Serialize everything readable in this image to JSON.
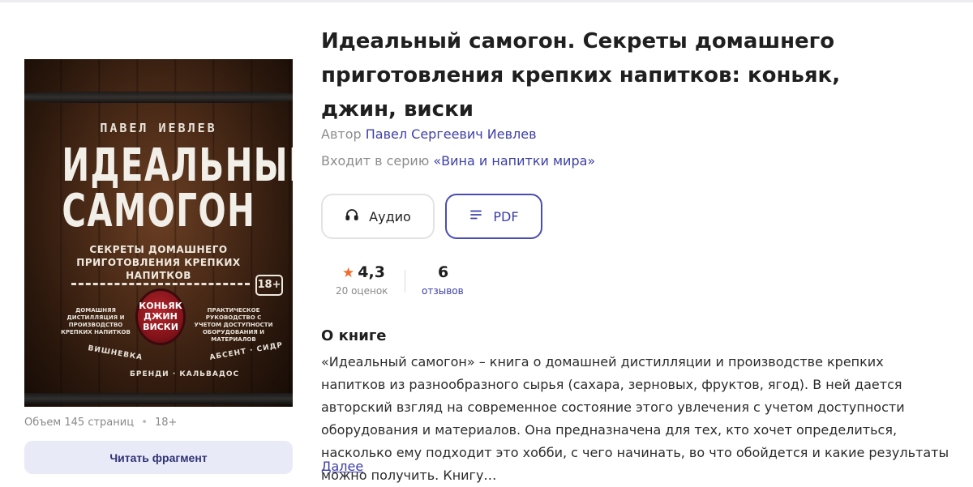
{
  "book": {
    "title": "Идеальный самогон. Секреты домашнего приготовления крепких напитков: коньяк, джин, виски",
    "author_prefix": "Автор",
    "author_name": "Павел Сергеевич Иевлев",
    "series_prefix": "Входит в серию",
    "series_name": "«Вина и напитки мира»",
    "pages_label": "Объем 145 страниц",
    "age_rating": "18+"
  },
  "cover": {
    "author": "ПАВЕЛ ИЕВЛЕВ",
    "title_line1": "ИДЕАЛЬНЫЙ",
    "title_line2": "САМОГОН",
    "subtitle": "СЕКРЕТЫ ДОМАШНЕГО ПРИГОТОВЛЕНИЯ КРЕПКИХ НАПИТКОВ",
    "age": "18+",
    "left_caption": "ДОМАШНЯЯ ДИСТИЛЛЯЦИЯ И ПРОИЗВОДСТВО КРЕПКИХ НАПИТКОВ",
    "right_caption": "ПРАКТИЧЕСКОЕ РУКОВОДСТВО С УЧЕТОМ ДОСТУПНОСТИ ОБОРУДОВАНИЯ И МАТЕРИАЛОВ",
    "seal_line1": "КОНЬЯК",
    "seal_line2": "ДЖИН",
    "seal_line3": "ВИСКИ",
    "arc1": "ВИШНЕВКА",
    "arc2": "АБСЕНТ · СИДР",
    "arc3": "БРЕНДИ · КАЛЬВАДОС"
  },
  "actions": {
    "read_fragment": "Читать фрагмент"
  },
  "formats": {
    "audio_label": "Аудио",
    "pdf_label": "PDF",
    "audio_icon": "headphones-icon",
    "pdf_icon": "document-lines-icon"
  },
  "stats": {
    "rating": "4,3",
    "rating_caption": "20 оценок",
    "reviews": "6",
    "reviews_caption": "отзывов",
    "star_color": "#f26b2b"
  },
  "about": {
    "heading": "О книге",
    "text": "«Идеальный самогон» – книга о домашней дистилляции и производстве крепких напитков из разнообразного сырья (сахара, зерновых, фруктов, ягод). В ней дается авторский взгляд на современное состояние этого увлечения с учетом доступности оборудования и материалов. Она предназначена для тех, кто хочет определиться, насколько ему подходит это хобби, с чего начинать, во что обойдется и какие результаты можно получить. Книгу…",
    "more_link": "Далее"
  },
  "colors": {
    "accent": "#3c3fa6",
    "read_button_bg": "#e9eaf7"
  }
}
